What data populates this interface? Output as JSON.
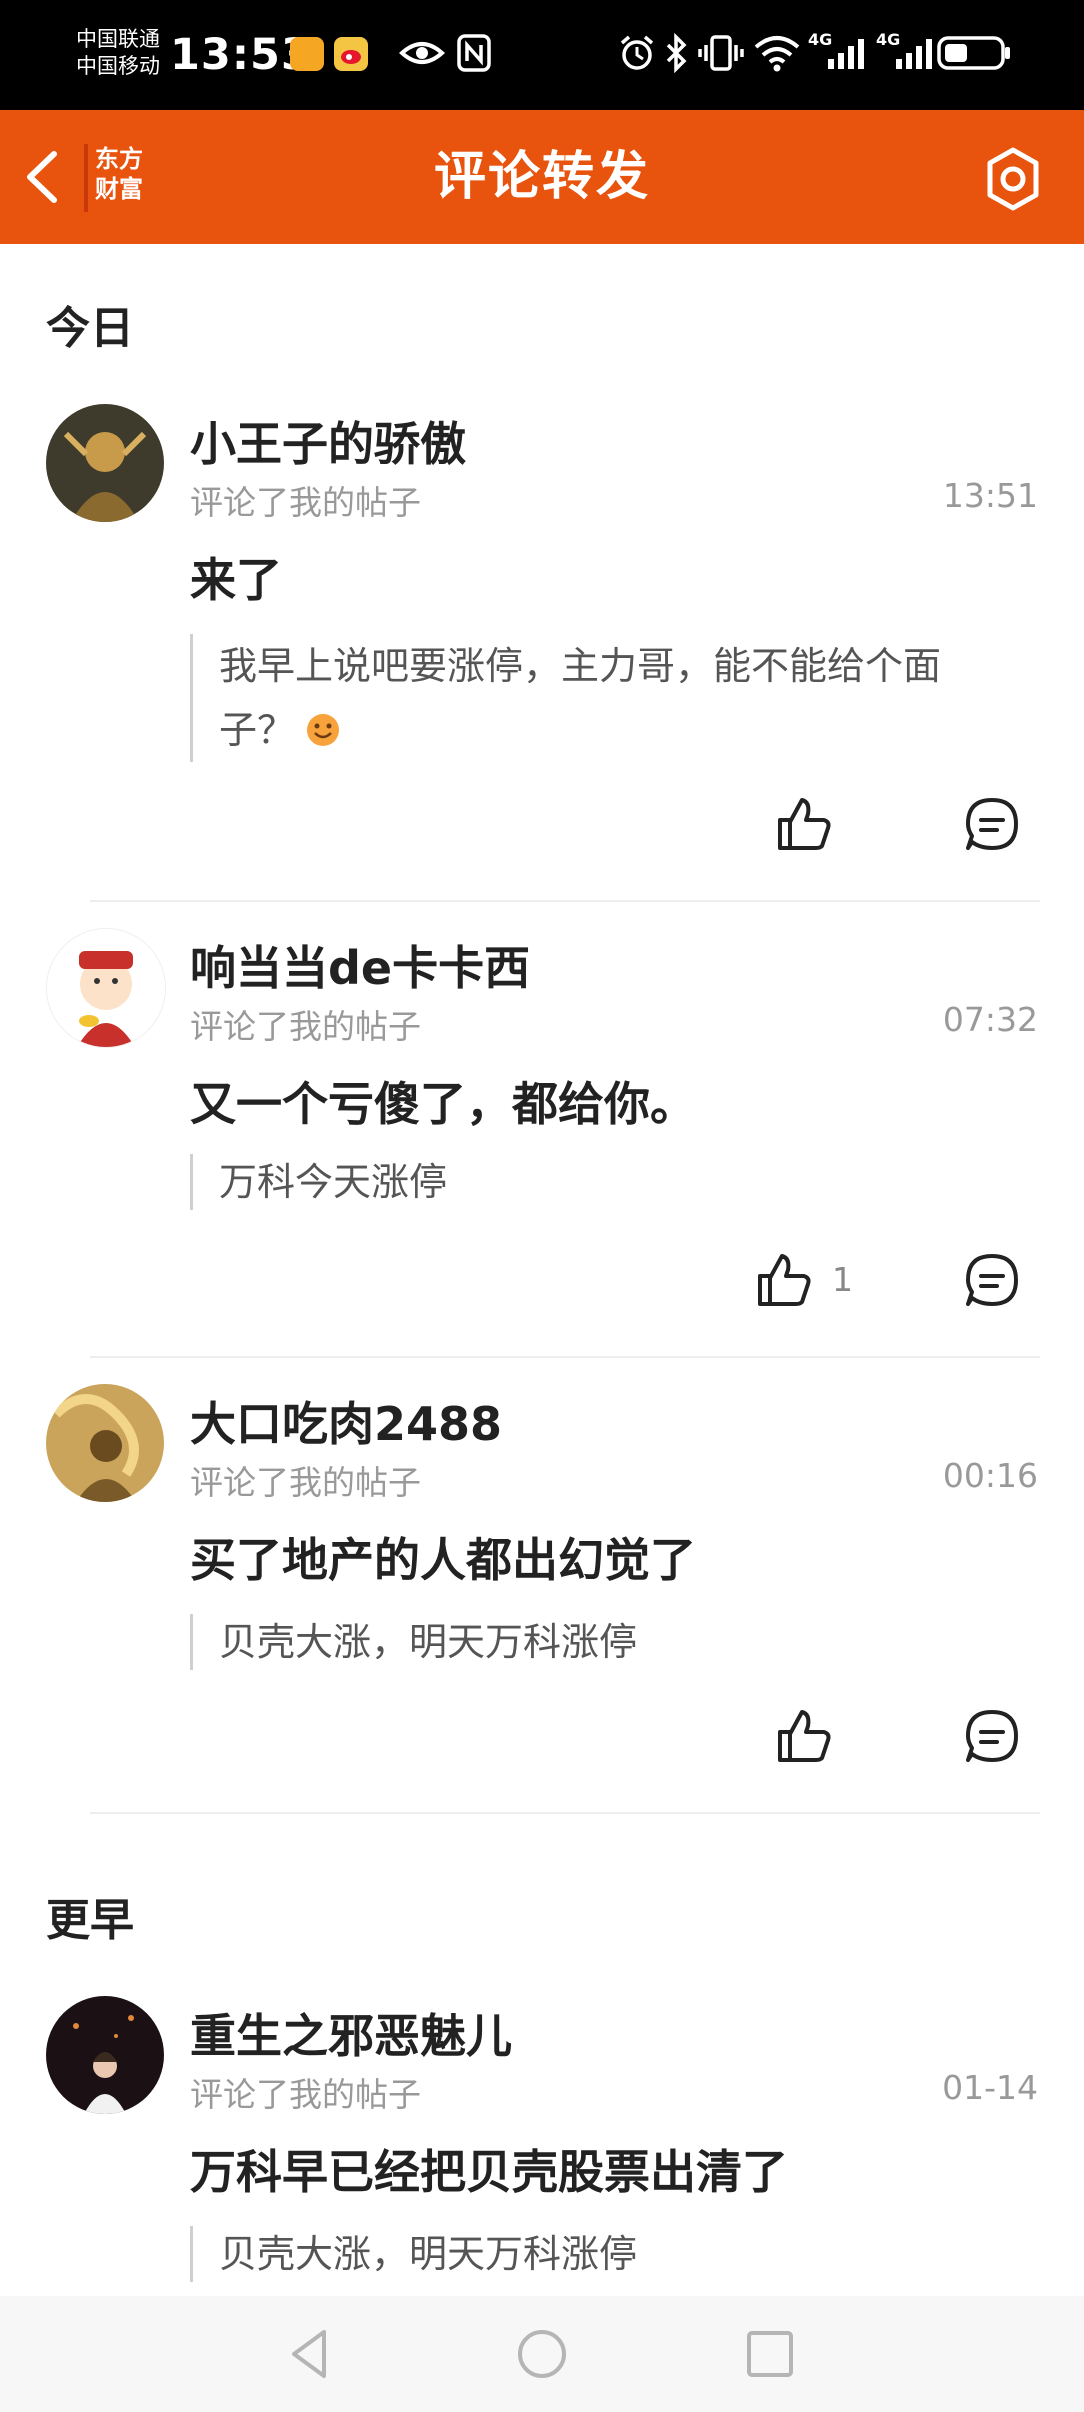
{
  "status_bar": {
    "carrier_1": "中国联通",
    "carrier_2": "中国移动",
    "time": "13:53",
    "net_1": "4G",
    "net_2": "4G"
  },
  "header": {
    "title": "评论转发",
    "logo_line1": "东方",
    "logo_line2": "财富",
    "accent_color": "#e8530d"
  },
  "sections": [
    {
      "title": "今日",
      "items": [
        {
          "username": "小王子的骄傲",
          "action": "评论了我的帖子",
          "time": "13:51",
          "comment": "来了",
          "quote_line1": "我早上说吧要涨停，主力哥，能不能给个面",
          "quote_line2": "子？",
          "like_count": ""
        },
        {
          "username": "响当当de卡卡西",
          "action": "评论了我的帖子",
          "time": "07:32",
          "comment": "又一个亏傻了，都给你。",
          "quote_line1": "万科今天涨停",
          "like_count": "1"
        },
        {
          "username": "大口吃肉2488",
          "action": "评论了我的帖子",
          "time": "00:16",
          "comment": "买了地产的人都出幻觉了",
          "quote_line1": "贝壳大涨，明天万科涨停",
          "like_count": ""
        }
      ]
    },
    {
      "title": "更早",
      "items": [
        {
          "username": "重生之邪恶魅儿",
          "action": "评论了我的帖子",
          "time": "01-14",
          "comment": "万科早已经把贝壳股票出清了",
          "quote_line1": "贝壳大涨，明天万科涨停"
        }
      ]
    }
  ],
  "icons": {
    "back": "back-arrow-icon",
    "settings": "gear-icon",
    "like": "thumbs-up-icon",
    "reply": "comment-bubble-icon",
    "emoji": "smiley-emoji-icon"
  }
}
